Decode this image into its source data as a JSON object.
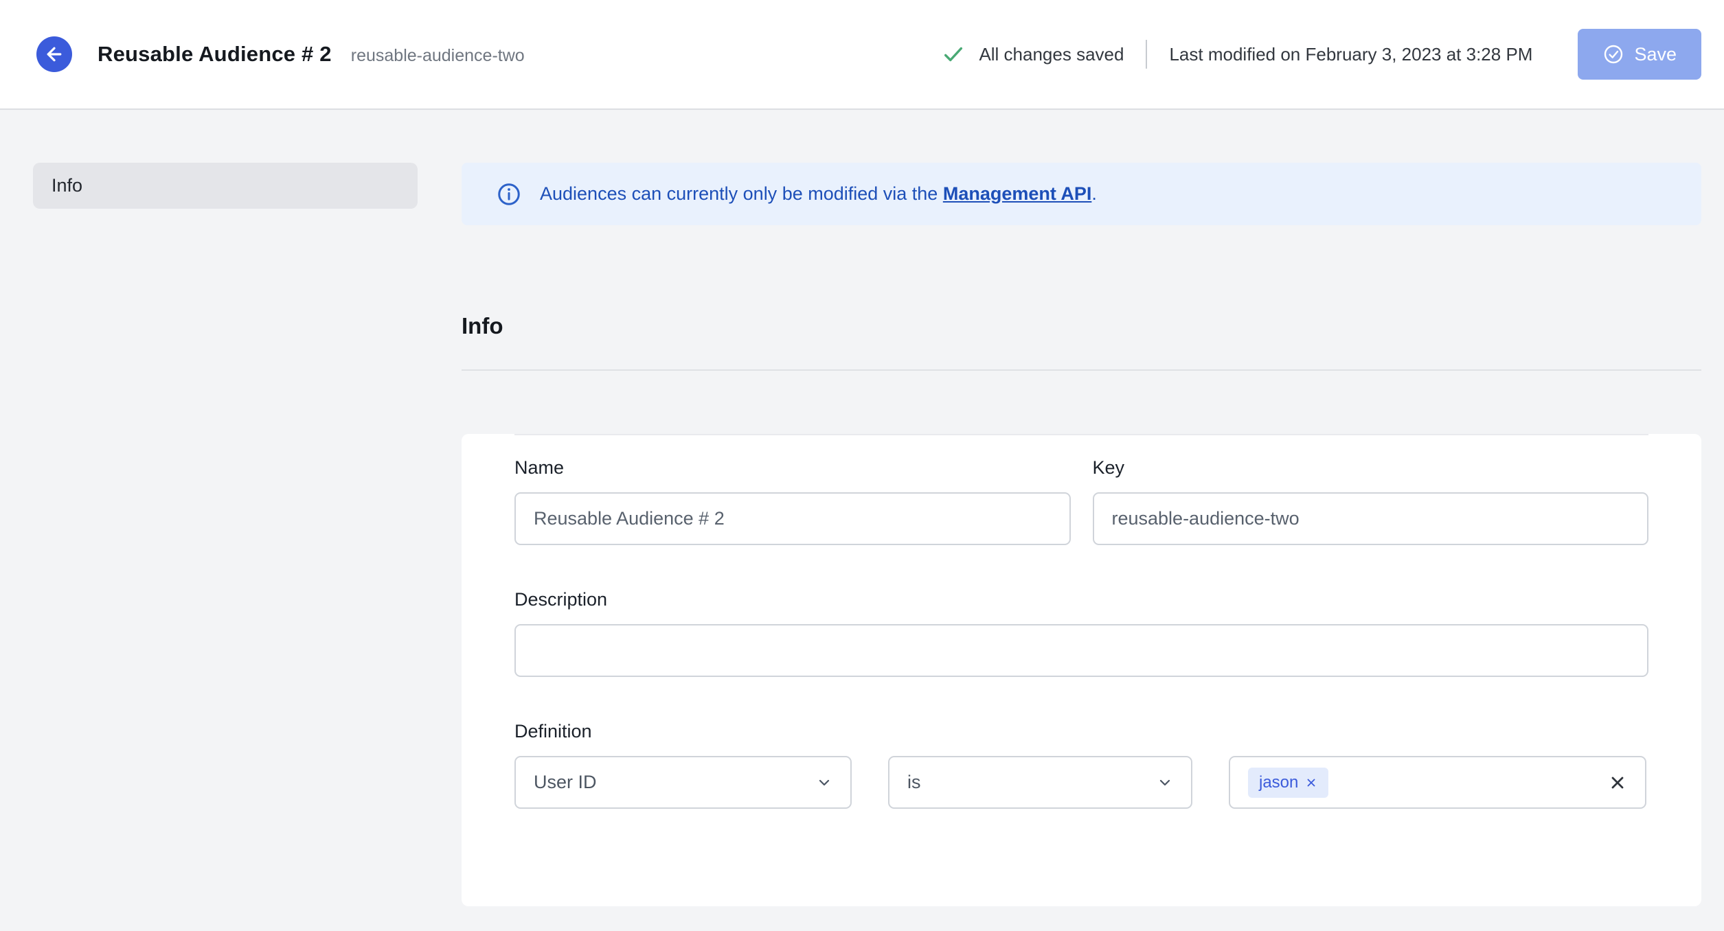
{
  "header": {
    "title": "Reusable Audience # 2",
    "slug": "reusable-audience-two",
    "saved_status": "All changes saved",
    "last_modified": "Last modified on February 3, 2023 at 3:28 PM",
    "save_label": "Save"
  },
  "sidebar": {
    "items": [
      {
        "label": "Info"
      }
    ]
  },
  "banner": {
    "text_before_link": "Audiences can currently only be modified via the ",
    "link_text": "Management API",
    "text_after_link": "."
  },
  "section": {
    "title": "Info"
  },
  "form": {
    "name": {
      "label": "Name",
      "value": "Reusable Audience # 2"
    },
    "key": {
      "label": "Key",
      "value": "reusable-audience-two"
    },
    "description": {
      "label": "Description",
      "value": ""
    },
    "definition": {
      "label": "Definition",
      "trait_select_value": "User ID",
      "operator_select_value": "is",
      "chips": [
        {
          "label": "jason"
        }
      ]
    }
  },
  "icons": {
    "back": "arrow-left-icon",
    "saved": "check-icon",
    "save": "circle-check-icon",
    "banner": "info-circle-icon",
    "select": "chevron-down-icon",
    "chip_remove": "x-icon",
    "clear_values": "x-icon"
  },
  "colors": {
    "brand_blue": "#3b5bdb",
    "save_button_bg": "#8da8ee",
    "success_green": "#49a974",
    "banner_bg": "#e9f1fd",
    "banner_text": "#1d4fb8",
    "chip_bg": "#e3ebfc",
    "chip_text": "#3b5bdb",
    "page_bg": "#f3f4f6"
  }
}
